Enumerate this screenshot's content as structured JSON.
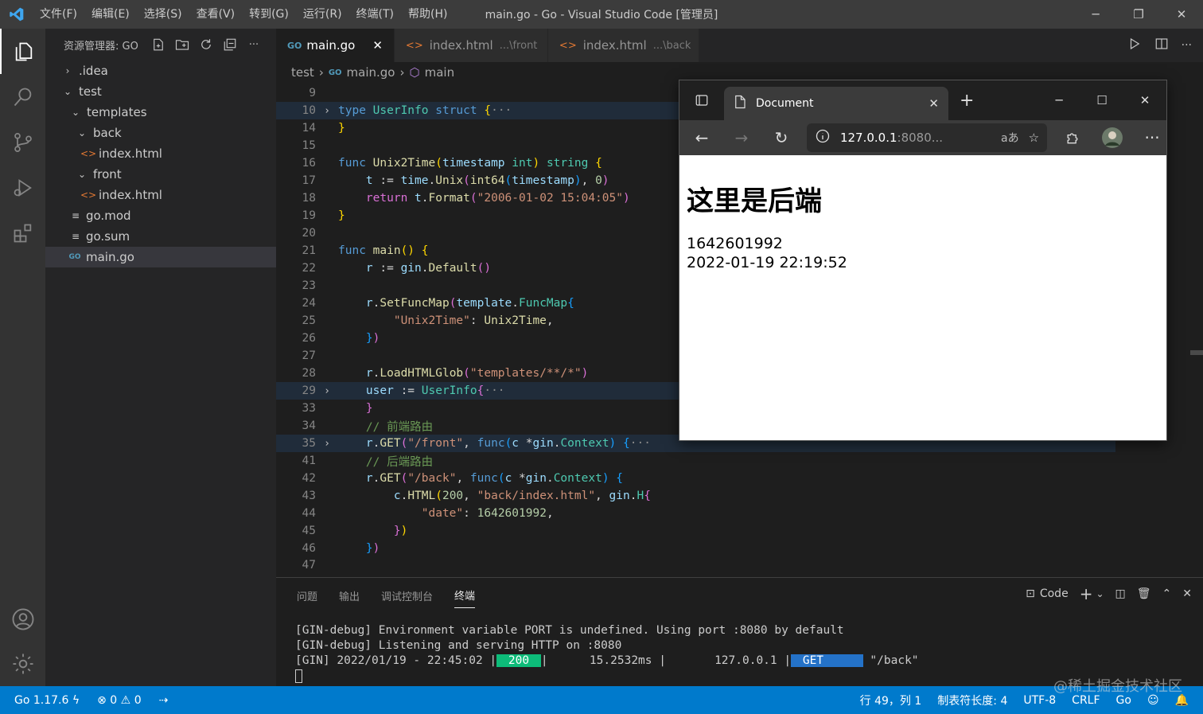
{
  "titlebar": {
    "menu": [
      "文件(F)",
      "编辑(E)",
      "选择(S)",
      "查看(V)",
      "转到(G)",
      "运行(R)",
      "终端(T)",
      "帮助(H)"
    ],
    "title": "main.go - Go - Visual Studio Code [管理员]"
  },
  "sidebar": {
    "header": "资源管理器: GO",
    "items": [
      {
        "label": ".idea",
        "chevron": "›"
      },
      {
        "label": "test",
        "chevron": "⌄"
      },
      {
        "label": "templates",
        "chevron": "⌄"
      },
      {
        "label": "back",
        "chevron": "⌄"
      },
      {
        "label": "index.html",
        "icon": "<>"
      },
      {
        "label": "front",
        "chevron": "⌄"
      },
      {
        "label": "index.html",
        "icon": "<>"
      },
      {
        "label": "go.mod",
        "icon": "≡"
      },
      {
        "label": "go.sum",
        "icon": "≡"
      },
      {
        "label": "main.go",
        "icon": "GO"
      }
    ]
  },
  "editor": {
    "tabs": [
      {
        "label": "main.go",
        "sub": "",
        "icon": "GO"
      },
      {
        "label": "index.html",
        "sub": "...\\front",
        "icon": "<>"
      },
      {
        "label": "index.html",
        "sub": "...\\back",
        "icon": "<>"
      }
    ],
    "breadcrumb": [
      "test",
      "main.go",
      "main"
    ],
    "line_numbers": [
      "9",
      "10",
      "14",
      "15",
      "16",
      "17",
      "18",
      "19",
      "20",
      "21",
      "22",
      "23",
      "24",
      "25",
      "26",
      "27",
      "28",
      "29",
      "33",
      "34",
      "35",
      "41",
      "42",
      "43",
      "44",
      "45",
      "46",
      "47"
    ]
  },
  "browser": {
    "tab_title": "Document",
    "address_host": "127.0.0.1",
    "address_rest": ":8080...",
    "heading": "这里是后端",
    "timestamp": "1642601992",
    "datetime": "2022-01-19 22:19:52"
  },
  "panel": {
    "tabs": [
      "问题",
      "输出",
      "调试控制台",
      "终端"
    ],
    "shell": "Code",
    "lines": [
      "[GIN-debug] Environment variable PORT is undefined. Using port :8080 by default",
      "[GIN-debug] Listening and serving HTTP on :8080"
    ],
    "gin_prefix": "[GIN] 2022/01/19 - 22:45:02 |",
    "status": " 200 ",
    "latency": "|      15.2532ms |       127.0.0.1 |",
    "method": " GET     ",
    "path": " \"/back\""
  },
  "statusbar": {
    "go_version": "Go 1.17.6",
    "errors": "0",
    "warnings": "0",
    "position": "行 49，列 1",
    "tab_size": "制表符长度: 4",
    "encoding": "UTF-8",
    "eol": "CRLF",
    "language": "Go"
  },
  "watermark": "@稀土掘金技术社区",
  "colors": {
    "accent": "#007acc",
    "status_ok": "#0dbc79",
    "method_get": "#2472c8"
  }
}
